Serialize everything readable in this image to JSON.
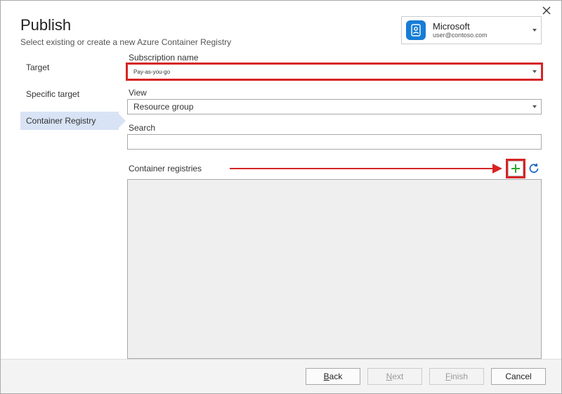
{
  "header": {
    "title": "Publish",
    "subtitle": "Select existing or create a new Azure Container Registry"
  },
  "account": {
    "name": "Microsoft",
    "email": "user@contoso.com"
  },
  "sidebar": {
    "items": [
      {
        "label": "Target"
      },
      {
        "label": "Specific target"
      },
      {
        "label": "Container Registry"
      }
    ]
  },
  "form": {
    "subscription": {
      "label": "Subscription name",
      "value": "Pay-as-you-go"
    },
    "view": {
      "label": "View",
      "value": "Resource group"
    },
    "search": {
      "label": "Search",
      "value": ""
    },
    "registries": {
      "label": "Container registries"
    }
  },
  "footer": {
    "back_prefix": "B",
    "back_rest": "ack",
    "next_prefix": "N",
    "next_rest": "ext",
    "finish_prefix": "F",
    "finish_rest": "inish",
    "cancel": "Cancel"
  }
}
